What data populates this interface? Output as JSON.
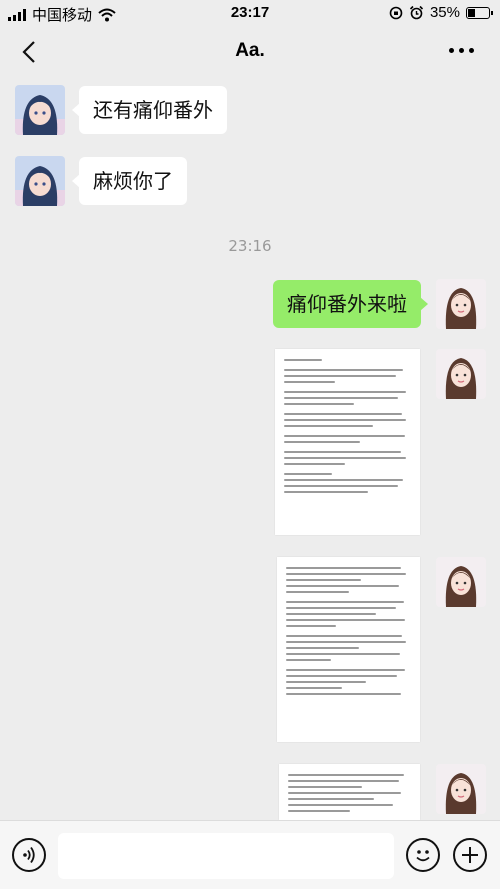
{
  "status_bar": {
    "carrier": "中国移动",
    "time": "23:17",
    "battery": "35%",
    "battery_level": 0.35
  },
  "nav": {
    "title": "Aa."
  },
  "messages": [
    {
      "side": "left",
      "text": "还有痛仰番外"
    },
    {
      "side": "left",
      "text": "麻烦你了"
    },
    {
      "side": "right",
      "text": "痛仰番外来啦"
    }
  ],
  "timestamp": "23:16",
  "colors": {
    "background": "#ededed",
    "my_bubble": "#95ec69",
    "their_bubble": "#ffffff"
  },
  "icons": {
    "back": "chevron-left-icon",
    "more": "ellipsis-icon",
    "voice": "voice-icon",
    "emoji": "emoji-icon",
    "add": "plus-icon"
  }
}
